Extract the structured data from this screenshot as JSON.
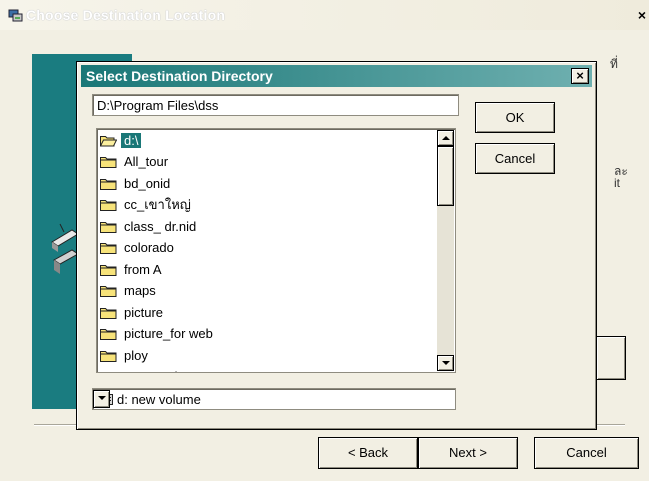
{
  "outer": {
    "title": "Choose Destination Location",
    "close": "×",
    "trail_top": "ที่",
    "trail_mid_1": "ละ",
    "trail_mid_2": "it",
    "back_label": "< Back",
    "next_label": "Next >",
    "cancel_label": "Cancel"
  },
  "dialog": {
    "title": "Select Destination Directory",
    "close": "×",
    "path_value": "D:\\Program Files\\dss",
    "ok_label": "OK",
    "cancel_label": "Cancel",
    "folders": [
      {
        "label": "d:\\",
        "selected": true,
        "open": true
      },
      {
        "label": "All_tour"
      },
      {
        "label": "bd_onid"
      },
      {
        "label": "cc_เขาใหญ่"
      },
      {
        "label": "class_ dr.nid"
      },
      {
        "label": "colorado"
      },
      {
        "label": "from A"
      },
      {
        "label": "maps"
      },
      {
        "label": "picture"
      },
      {
        "label": "picture_for web"
      },
      {
        "label": "ploy"
      },
      {
        "label": "post card"
      }
    ],
    "drive_value": "d:  new volume"
  },
  "colors": {
    "title_teal": "#1a7777",
    "panel_teal": "#1a7c80",
    "face": "#f2efe3",
    "folder_yellow": "#f7e37a"
  }
}
